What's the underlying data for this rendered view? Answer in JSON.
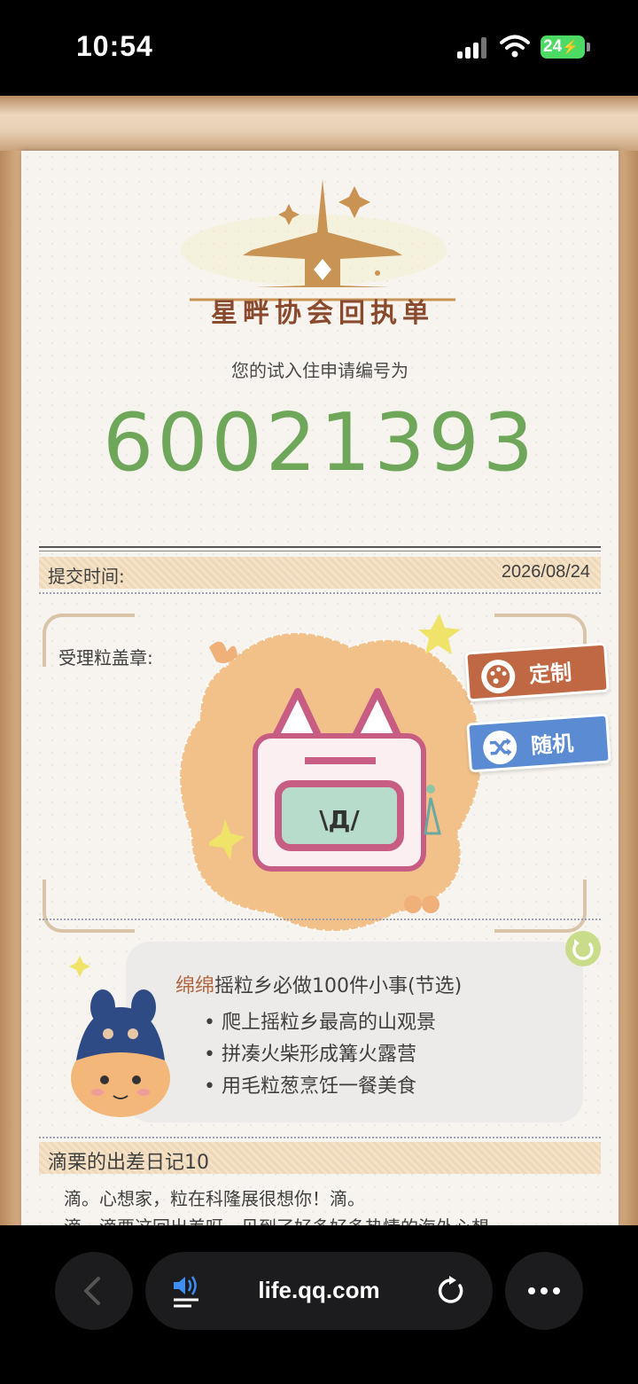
{
  "status_bar": {
    "time": "10:54",
    "battery": "24"
  },
  "receipt": {
    "logo_title": "星畔协会回执单",
    "application_intro": "您的试入住申请编号为",
    "application_number": "60021393",
    "submit_label": "提交时间:",
    "submit_date": "2026/08/24",
    "stamp_label": "受理粒盖章:",
    "stamp_face": "\\Д/",
    "custom_button": "定制",
    "random_button": "随机"
  },
  "todo": {
    "title_highlight": "绵绵",
    "title_rest": "摇粒乡必做100件小事(节选)",
    "items": [
      "• 爬上摇粒乡最高的山观景",
      "• 拼凑火柴形成篝火露营",
      "• 用毛粒葱烹饪一餐美食"
    ]
  },
  "diary": {
    "title": "滴栗的出差日记10",
    "lines": [
      "滴。心想家，粒在科隆展很想你！滴。",
      "滴，滴栗这回出差呀，见到了好多好多热情的海外心想"
    ]
  },
  "browser": {
    "url": "life.qq.com"
  },
  "colors": {
    "number_green": "#6fa75a",
    "logo_brown": "#8a4a2d",
    "custom_button": "#c06844",
    "random_button": "#5b8bd3",
    "refresh": "#c9dc8a"
  }
}
